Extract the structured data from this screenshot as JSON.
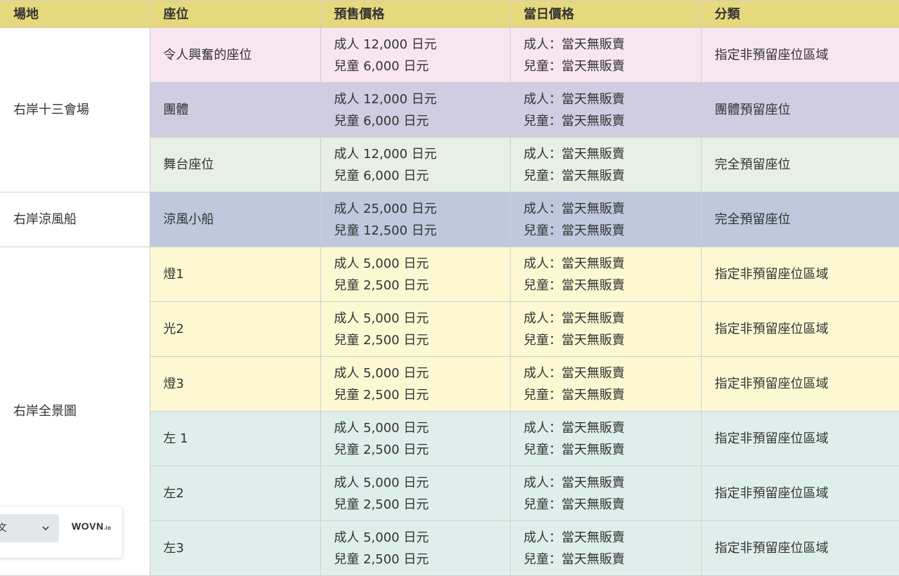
{
  "headers": [
    "場地",
    "座位",
    "預售價格",
    "當日價格",
    "分類"
  ],
  "venues": [
    {
      "name": "右岸十三會場",
      "rowspan": 3
    },
    {
      "name": "右岸涼風船",
      "rowspan": 1
    },
    {
      "name": "右岸全景圖",
      "rowspan": 6
    }
  ],
  "rows": [
    {
      "seat": "令人興奮的座位",
      "presale": [
        "成人 12,000 日元",
        "兒童 6,000 日元"
      ],
      "sameday": [
        "成人：當天無販賣",
        "兒童：當天無販賣"
      ],
      "category": "指定非預留座位區域",
      "color_class": "row-pink"
    },
    {
      "seat": "團體",
      "presale": [
        "成人 12,000 日元",
        "兒童 6,000 日元"
      ],
      "sameday": [
        "成人：當天無販賣",
        "兒童：當天無販賣"
      ],
      "category": "團體預留座位",
      "color_class": "row-purple"
    },
    {
      "seat": "舞台座位",
      "presale": [
        "成人 12,000 日元",
        "兒童 6,000 日元"
      ],
      "sameday": [
        "成人：當天無販賣",
        "兒童：當天無販賣"
      ],
      "category": "完全預留座位",
      "color_class": "row-green"
    },
    {
      "seat": "涼風小船",
      "presale": [
        "成人 25,000 日元",
        "兒童 12,500 日元"
      ],
      "sameday": [
        "成人：當天無販賣",
        "兒童：當天無販賣"
      ],
      "category": "完全預留座位",
      "color_class": "row-blue"
    },
    {
      "seat": "燈1",
      "presale": [
        "成人 5,000 日元",
        "兒童 2,500 日元"
      ],
      "sameday": [
        "成人：當天無販賣",
        "兒童：當天無販賣"
      ],
      "category": "指定非預留座位區域",
      "color_class": "row-yellow"
    },
    {
      "seat": "光2",
      "presale": [
        "成人 5,000 日元",
        "兒童 2,500 日元"
      ],
      "sameday": [
        "成人：當天無販賣",
        "兒童：當天無販賣"
      ],
      "category": "指定非預留座位區域",
      "color_class": "row-yellow"
    },
    {
      "seat": "燈3",
      "presale": [
        "成人 5,000 日元",
        "兒童 2,500 日元"
      ],
      "sameday": [
        "成人：當天無販賣",
        "兒童：當天無販賣"
      ],
      "category": "指定非預留座位區域",
      "color_class": "row-yellow"
    },
    {
      "seat": "左 1",
      "presale": [
        "成人 5,000 日元",
        "兒童 2,500 日元"
      ],
      "sameday": [
        "成人：當天無販賣",
        "兒童：當天無販賣"
      ],
      "category": "指定非預留座位區域",
      "color_class": "row-teal"
    },
    {
      "seat": "左2",
      "presale": [
        "成人 5,000 日元",
        "兒童 2,500 日元"
      ],
      "sameday": [
        "成人：當天無販賣",
        "兒童：當天無販賣"
      ],
      "category": "指定非預留座位區域",
      "color_class": "row-teal"
    },
    {
      "seat": "左3",
      "presale": [
        "成人 5,000 日元",
        "兒童 2,500 日元"
      ],
      "sameday": [
        "成人：當天無販賣",
        "兒童：當天無販賣"
      ],
      "category": "指定非預留座位區域",
      "color_class": "row-teal"
    }
  ],
  "colors": {
    "header": "#e6d87c",
    "row-pink": "#f7e6ef",
    "row-purple": "#d0cde2",
    "row-green": "#e8efe4",
    "row-blue": "#bec9de",
    "row-yellow": "#fbf8d2",
    "row-teal": "#deefeb"
  },
  "language_widget": {
    "selected_language": "文",
    "selector_icon": "chevron-down-icon",
    "brand": "WOVN",
    "brand_suffix": ".io"
  }
}
